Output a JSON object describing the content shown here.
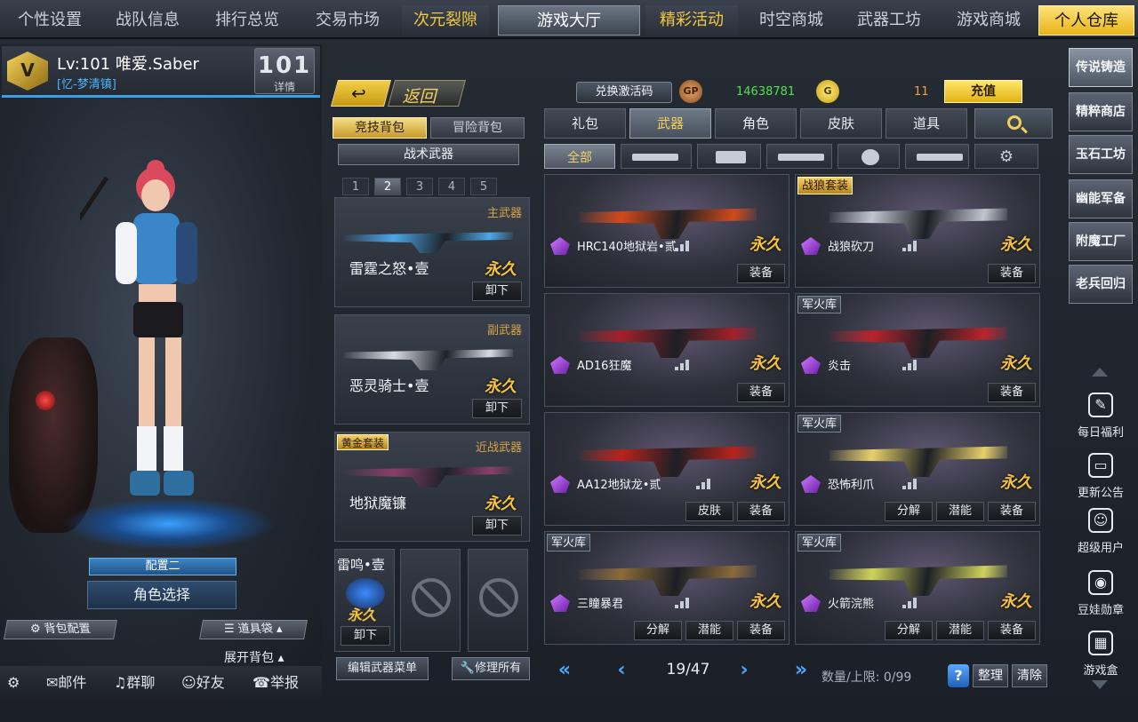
{
  "top_nav": [
    {
      "label": "个性设置",
      "style": "normal"
    },
    {
      "label": "战队信息",
      "style": "normal"
    },
    {
      "label": "排行总览",
      "style": "normal"
    },
    {
      "label": "交易市场",
      "style": "normal"
    },
    {
      "label": "次元裂隙",
      "style": "highlight"
    },
    {
      "label": "游戏大厅",
      "style": "active"
    },
    {
      "label": "精彩活动",
      "style": "highlight"
    },
    {
      "label": "时空商城",
      "style": "normal"
    },
    {
      "label": "武器工坊",
      "style": "normal"
    },
    {
      "label": "游戏商城",
      "style": "normal"
    },
    {
      "label": "个人仓库",
      "style": "gold"
    }
  ],
  "player": {
    "rank_emblem": "V",
    "level_name": "Lv:101 唯爱.Saber",
    "clan": "[忆-梦清镇]",
    "rank_number": "101",
    "rank_detail": "详情"
  },
  "character": {
    "config_label": "配置二",
    "role_select": "角色选择",
    "bag_config": "背包配置",
    "item_bag": "道具袋",
    "expand_bag": "展开背包"
  },
  "bottom_bar": [
    {
      "icon": "gear-icon",
      "label": ""
    },
    {
      "icon": "mail-icon",
      "label": "邮件"
    },
    {
      "icon": "group-chat-icon",
      "label": "群聊"
    },
    {
      "icon": "friends-icon",
      "label": "好友"
    },
    {
      "icon": "report-icon",
      "label": "举报"
    }
  ],
  "middle": {
    "back_label": "返回",
    "bag_tabs": [
      {
        "label": "竞技背包",
        "active": true
      },
      {
        "label": "冒险背包",
        "active": false
      }
    ],
    "tactical_label": "战术武器",
    "pages": [
      "1",
      "2",
      "3",
      "4",
      "5"
    ],
    "active_page": "2",
    "slots": [
      {
        "category": "主武器",
        "name": "雷霆之怒•壹",
        "duration": "永久",
        "action": "卸下",
        "tag": ""
      },
      {
        "category": "副武器",
        "name": "恶灵骑士•壹",
        "duration": "永久",
        "action": "卸下",
        "tag": ""
      },
      {
        "category": "近战武器",
        "name": "地狱魔镰",
        "duration": "永久",
        "action": "卸下",
        "tag": "黄金套装"
      }
    ],
    "mini_slot": {
      "name": "雷鸣•壹",
      "duration": "永久",
      "action": "卸下"
    },
    "edit_menu": "编辑武器菜单",
    "repair_all": "修理所有"
  },
  "currency": {
    "redeem_label": "兑换激活码",
    "gp_icon": "GP",
    "gp_value": "14638781",
    "gold_icon": "G",
    "gold_value": "11",
    "recharge_label": "充值"
  },
  "category_tabs": [
    {
      "label": "礼包",
      "active": false
    },
    {
      "label": "武器",
      "active": true
    },
    {
      "label": "角色",
      "active": false
    },
    {
      "label": "皮肤",
      "active": false
    },
    {
      "label": "道具",
      "active": false
    }
  ],
  "filter_tabs": [
    {
      "label": "全部",
      "icon": "",
      "active": true
    },
    {
      "label": "",
      "icon": "rifle-icon",
      "active": false
    },
    {
      "label": "",
      "icon": "pistol-icon",
      "active": false
    },
    {
      "label": "",
      "icon": "sniper-icon",
      "active": false
    },
    {
      "label": "",
      "icon": "grenade-icon",
      "active": false
    },
    {
      "label": "",
      "icon": "smg-icon",
      "active": false
    },
    {
      "label": "",
      "icon": "gear-icon",
      "active": false
    }
  ],
  "items": [
    {
      "tag": "",
      "tag_style": "",
      "name": "HRC140地狱岩•贰",
      "duration": "永久",
      "actions": [
        "装备"
      ],
      "color": "#d04a1a"
    },
    {
      "tag": "战狼套装",
      "tag_style": "gold",
      "name": "战狼砍刀",
      "duration": "永久",
      "actions": [
        "装备"
      ],
      "color": "#c0c6cf"
    },
    {
      "tag": "",
      "tag_style": "",
      "name": "AD16狂魔",
      "duration": "永久",
      "actions": [
        "装备"
      ],
      "color": "#a3202a"
    },
    {
      "tag": "军火库",
      "tag_style": "dark",
      "name": "炎击",
      "duration": "永久",
      "actions": [
        "装备"
      ],
      "color": "#b8242c"
    },
    {
      "tag": "",
      "tag_style": "",
      "name": "AA12地狱龙•贰",
      "duration": "永久",
      "actions": [
        "皮肤",
        "装备"
      ],
      "color": "#b8221c"
    },
    {
      "tag": "军火库",
      "tag_style": "dark",
      "name": "恐怖利爪",
      "duration": "永久",
      "actions": [
        "分解",
        "潜能",
        "装备"
      ],
      "color": "#e6d06a"
    },
    {
      "tag": "军火库",
      "tag_style": "dark",
      "name": "三瞳暴君",
      "duration": "永久",
      "actions": [
        "分解",
        "潜能",
        "装备"
      ],
      "color": "#8a6a3a"
    },
    {
      "tag": "军火库",
      "tag_style": "dark",
      "name": "火箭浣熊",
      "duration": "永久",
      "actions": [
        "分解",
        "潜能",
        "装备"
      ],
      "color": "#cfd35a"
    }
  ],
  "pager": {
    "page_info": "19/47",
    "quota": "数量/上限: 0/99",
    "help": "?",
    "sort_label": "整理",
    "clear_label": "清除"
  },
  "sidebar": {
    "buttons": [
      "传说铸造",
      "精粹商店",
      "玉石工坊",
      "幽能军备",
      "附魔工厂",
      "老兵回归"
    ],
    "active_button": "传说铸造",
    "icons": [
      {
        "label": "每日福利",
        "icon": "daily-welfare-icon"
      },
      {
        "label": "更新公告",
        "icon": "announcement-icon"
      },
      {
        "label": "超级用户",
        "icon": "super-user-icon"
      },
      {
        "label": "豆娃勋章",
        "icon": "medal-icon"
      },
      {
        "label": "游戏盒",
        "icon": "game-box-icon"
      }
    ]
  }
}
